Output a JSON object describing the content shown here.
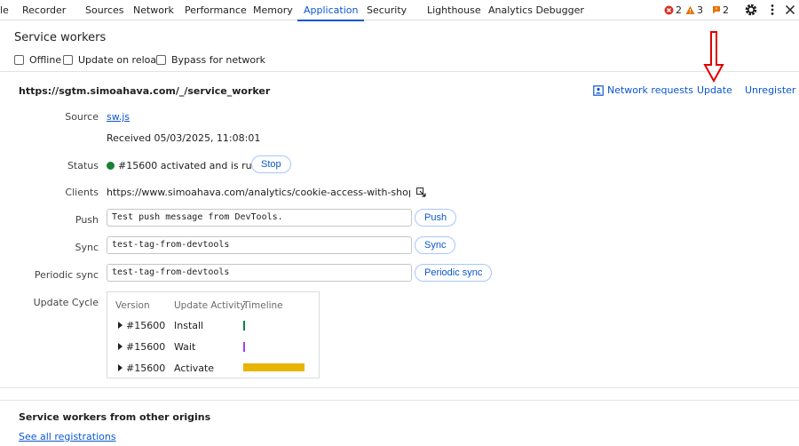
{
  "tabs": [
    {
      "label": "le"
    },
    {
      "label": "Recorder"
    },
    {
      "label": "Sources"
    },
    {
      "label": "Network"
    },
    {
      "label": "Performance"
    },
    {
      "label": "Memory"
    },
    {
      "label": "Application"
    },
    {
      "label": "Security"
    },
    {
      "label": "Lighthouse"
    },
    {
      "label": "Analytics Debugger"
    }
  ],
  "badges": {
    "errors": "2",
    "warnings": "3",
    "issues": "2"
  },
  "colors": {
    "accent": "#0b57d0",
    "error": "#d93025",
    "warning": "#e37400",
    "status_running": "#188038",
    "install": "#0b8043",
    "wait": "#a142f4",
    "activate": "#e8b400",
    "annotation_arrow": "#e00000"
  },
  "section": {
    "title": "Service workers",
    "checkboxes": [
      "Offline",
      "Update on reload",
      "Bypass for network"
    ]
  },
  "worker": {
    "scope": "https://sgtm.simoahava.com/_/service_worker",
    "actions": {
      "network_requests": "Network requests",
      "update": "Update",
      "unregister": "Unregister"
    },
    "source_label": "Source",
    "source_file": "sw.js",
    "received": "Received 05/03/2025, 11:08:01",
    "status_label": "Status",
    "status_text": "#15600 activated and is running",
    "stop_label": "Stop",
    "clients_label": "Clients",
    "clients_url": "https://www.simoahava.com/analytics/cookie-access-with-shopify-checko…",
    "push_label": "Push",
    "push_value": "Test push message from DevTools.",
    "push_button": "Push",
    "sync_label": "Sync",
    "sync_value": "test-tag-from-devtools",
    "sync_button": "Sync",
    "periodic_label": "Periodic sync",
    "periodic_value": "test-tag-from-devtools",
    "periodic_button": "Periodic sync",
    "update_cycle_label": "Update Cycle",
    "update_cycle": {
      "headers": [
        "Version",
        "Update Activity",
        "Timeline"
      ],
      "rows": [
        {
          "version": "#15600",
          "activity": "Install"
        },
        {
          "version": "#15600",
          "activity": "Wait"
        },
        {
          "version": "#15600",
          "activity": "Activate"
        }
      ]
    }
  },
  "other_origins": {
    "title": "Service workers from other origins",
    "link": "See all registrations"
  },
  "icons": {
    "settings": "gear-icon",
    "more": "more-vertical-icon",
    "close": "close-icon",
    "network_requests": "network-requests-icon",
    "reveal": "reveal-icon",
    "annotation": "red-down-arrow-icon"
  }
}
